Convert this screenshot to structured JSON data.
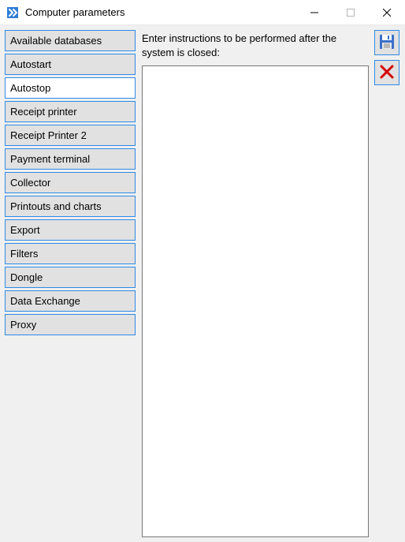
{
  "window": {
    "title": "Computer parameters"
  },
  "sidebar": {
    "items": [
      {
        "label": "Available databases",
        "selected": false
      },
      {
        "label": "Autostart",
        "selected": false
      },
      {
        "label": "Autostop",
        "selected": true
      },
      {
        "label": "Receipt printer",
        "selected": false
      },
      {
        "label": "Receipt Printer 2",
        "selected": false
      },
      {
        "label": "Payment terminal",
        "selected": false
      },
      {
        "label": "Collector",
        "selected": false
      },
      {
        "label": "Printouts and charts",
        "selected": false
      },
      {
        "label": "Export",
        "selected": false
      },
      {
        "label": "Filters",
        "selected": false
      },
      {
        "label": "Dongle",
        "selected": false
      },
      {
        "label": "Data Exchange",
        "selected": false
      },
      {
        "label": "Proxy",
        "selected": false
      }
    ]
  },
  "main": {
    "instruction_label": "Enter instructions to be performed after the system is closed:",
    "instructions_value": ""
  },
  "tools": {
    "save_name": "save-icon",
    "cancel_name": "cancel-icon"
  }
}
